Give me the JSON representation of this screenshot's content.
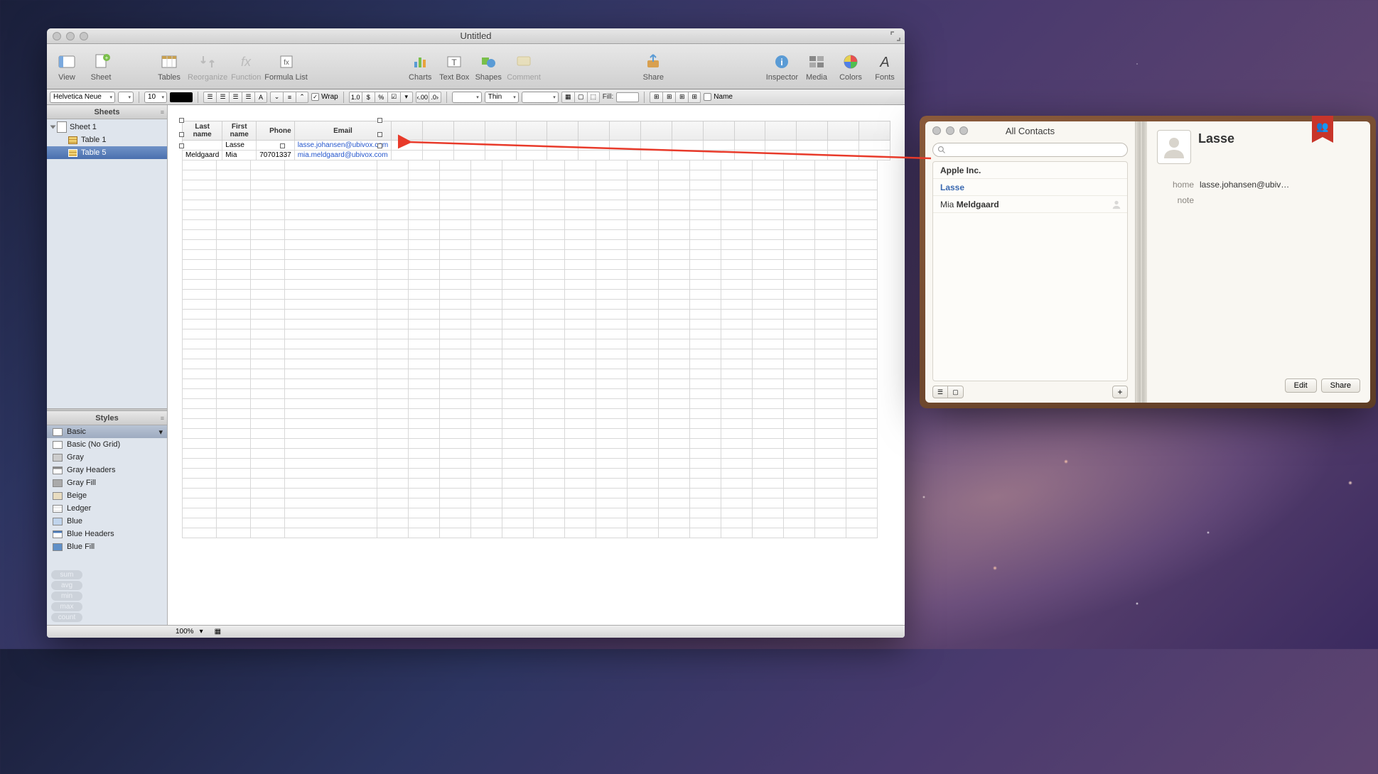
{
  "numbers": {
    "title": "Untitled",
    "toolbar": {
      "view": "View",
      "sheet": "Sheet",
      "tables": "Tables",
      "reorganize": "Reorganize",
      "function": "Function",
      "formula_list": "Formula List",
      "charts": "Charts",
      "textbox": "Text Box",
      "shapes": "Shapes",
      "comment": "Comment",
      "share": "Share",
      "inspector": "Inspector",
      "media": "Media",
      "colors": "Colors",
      "fonts": "Fonts"
    },
    "formatbar": {
      "font": "Helvetica Neue",
      "size": "10",
      "wrap": "Wrap",
      "num": "1.0",
      "stroke": "Thin",
      "fill": "Fill:",
      "name_chk": "Name"
    },
    "sidebar": {
      "sheets_head": "Sheets",
      "sheet": "Sheet 1",
      "tables": [
        "Table 1",
        "Table 5"
      ],
      "styles_head": "Styles",
      "styles": [
        "Basic",
        "Basic (No Grid)",
        "Gray",
        "Gray Headers",
        "Gray Fill",
        "Beige",
        "Ledger",
        "Blue",
        "Blue Headers",
        "Blue Fill"
      ],
      "agg": [
        "sum",
        "avg",
        "min",
        "max",
        "count"
      ]
    },
    "table": {
      "headers": [
        "Last name",
        "First name",
        "Phone",
        "Email"
      ],
      "rows": [
        {
          "last": "",
          "first": "Lasse",
          "phone": "",
          "email": "lasse.johansen@ubivox.com"
        },
        {
          "last": "Meldgaard",
          "first": "Mia",
          "phone": "70701337",
          "email": "mia.meldgaard@ubivox.com"
        }
      ]
    },
    "status": {
      "zoom": "100%"
    }
  },
  "contacts": {
    "title": "All Contacts",
    "list": [
      {
        "text": "Apple Inc.",
        "cls": "group"
      },
      {
        "text": "Lasse",
        "cls": "sel"
      },
      {
        "text_first": "Mia",
        "text_last": "Meldgaard",
        "cls": "normal",
        "person": true
      }
    ],
    "card": {
      "name": "Lasse",
      "email_label": "home",
      "email": "lasse.johansen@ubiv…",
      "note_label": "note"
    },
    "buttons": {
      "edit": "Edit",
      "share": "Share"
    }
  }
}
